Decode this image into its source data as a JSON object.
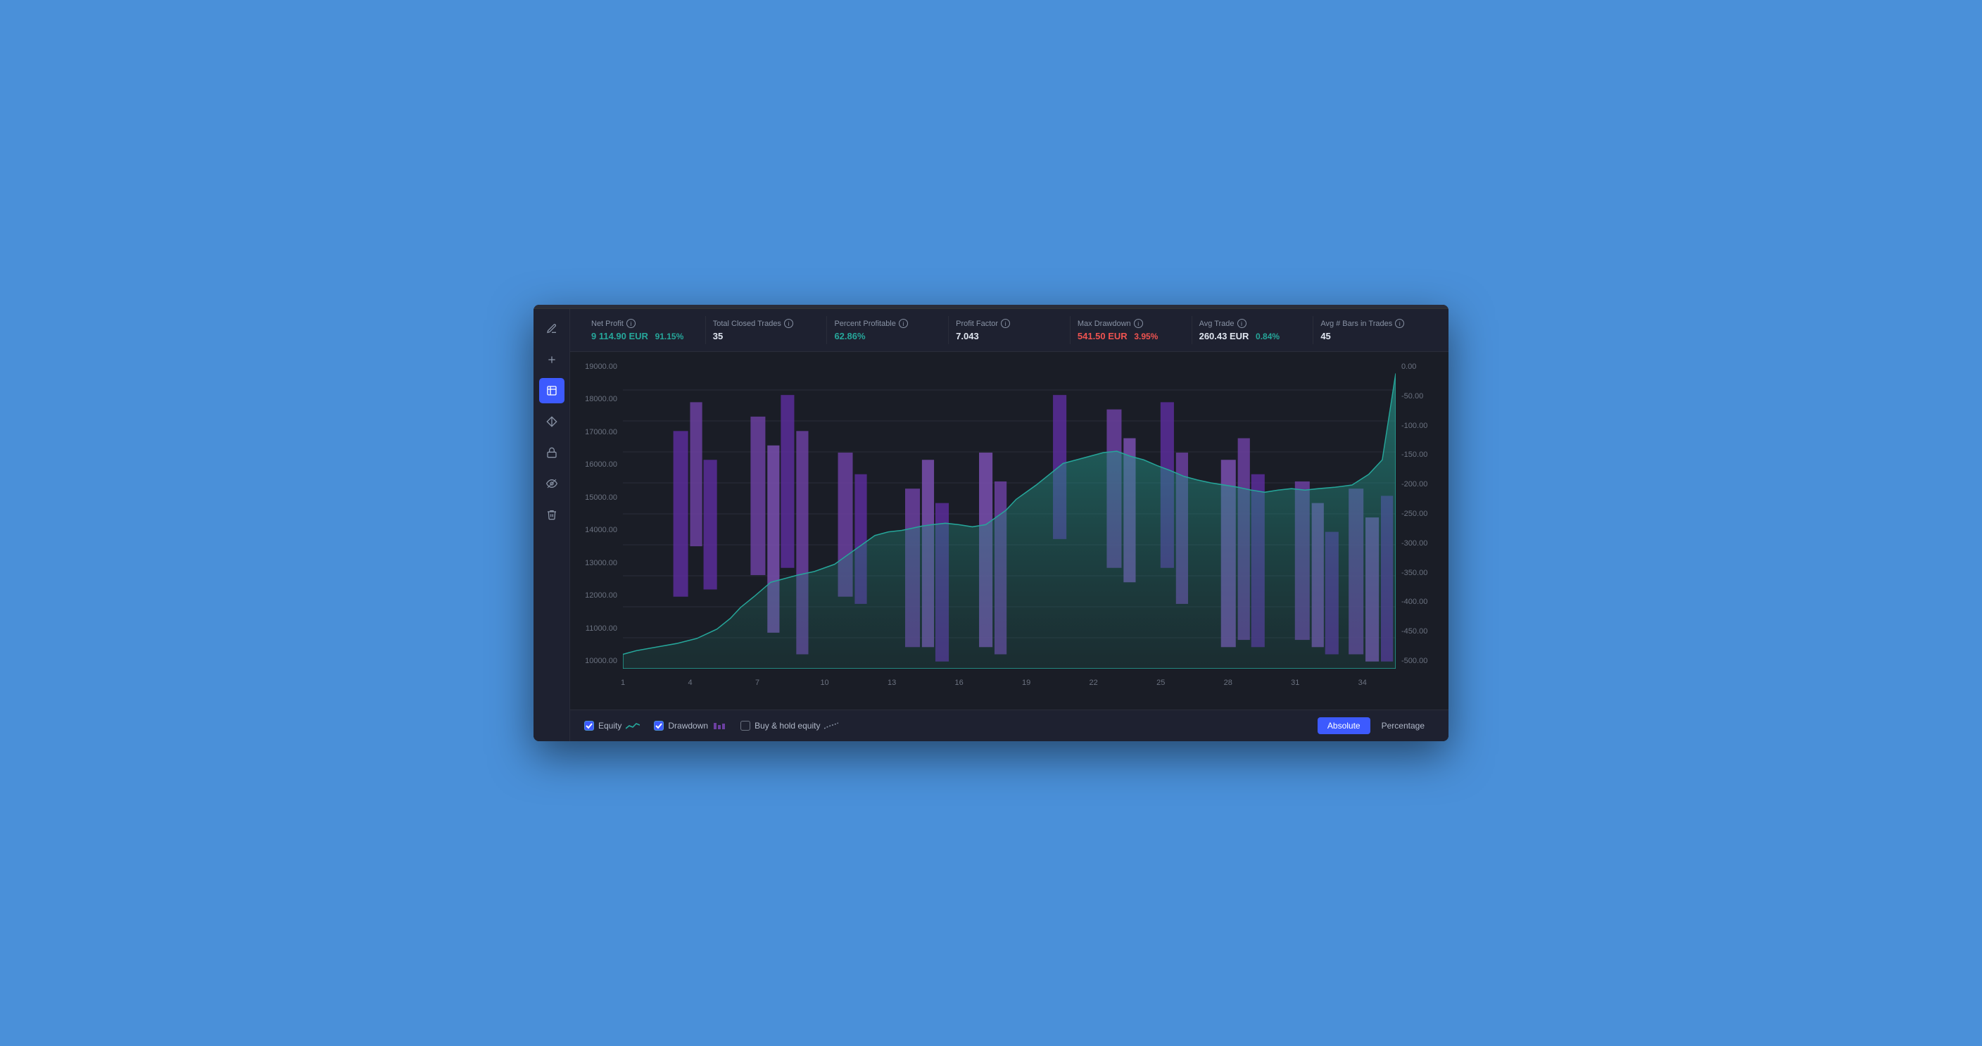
{
  "stats": [
    {
      "id": "net-profit",
      "label": "Net Profit",
      "value": "9 114.90 EUR",
      "secondary": "91.15%",
      "secondary_color": "green"
    },
    {
      "id": "total-closed-trades",
      "label": "Total Closed Trades",
      "value": "35",
      "secondary": null,
      "secondary_color": null
    },
    {
      "id": "percent-profitable",
      "label": "Percent Profitable",
      "value": "62.86%",
      "secondary": null,
      "secondary_color": "green"
    },
    {
      "id": "profit-factor",
      "label": "Profit Factor",
      "value": "7.043",
      "secondary": null,
      "secondary_color": null
    },
    {
      "id": "max-drawdown",
      "label": "Max Drawdown",
      "value": "541.50 EUR",
      "secondary": "3.95%",
      "secondary_color": "red"
    },
    {
      "id": "avg-trade",
      "label": "Avg Trade",
      "value": "260.43 EUR",
      "secondary": "0.84%",
      "secondary_color": "green"
    },
    {
      "id": "avg-bars-in-trades",
      "label": "Avg # Bars in Trades",
      "value": "45",
      "secondary": null,
      "secondary_color": null
    }
  ],
  "y_axis_left": [
    "19000.00",
    "18000.00",
    "17000.00",
    "16000.00",
    "15000.00",
    "14000.00",
    "13000.00",
    "12000.00",
    "11000.00",
    "10000.00"
  ],
  "y_axis_right": [
    "0.00",
    "-50.00",
    "-100.00",
    "-150.00",
    "-200.00",
    "-250.00",
    "-300.00",
    "-350.00",
    "-400.00",
    "-450.00",
    "-500.00"
  ],
  "x_axis": [
    "1",
    "4",
    "7",
    "10",
    "13",
    "16",
    "19",
    "22",
    "25",
    "28",
    "31",
    "34"
  ],
  "legend": [
    {
      "id": "equity",
      "label": "Equity",
      "checked": true,
      "icon": "equity-icon"
    },
    {
      "id": "drawdown",
      "label": "Drawdown",
      "checked": true,
      "icon": "drawdown-icon"
    },
    {
      "id": "buy-hold",
      "label": "Buy & hold equity",
      "checked": false,
      "icon": "line-icon"
    }
  ],
  "view_buttons": [
    {
      "id": "absolute",
      "label": "Absolute",
      "active": true
    },
    {
      "id": "percentage",
      "label": "Percentage",
      "active": false
    }
  ],
  "sidebar_icons": [
    {
      "id": "pencil",
      "icon": "✏️",
      "active": false
    },
    {
      "id": "plus",
      "icon": "＋",
      "active": false
    },
    {
      "id": "cursor",
      "icon": "📌",
      "active": true
    },
    {
      "id": "ruler",
      "icon": "📐",
      "active": false
    },
    {
      "id": "lock",
      "icon": "🔒",
      "active": false
    },
    {
      "id": "eye",
      "icon": "👁",
      "active": false
    },
    {
      "id": "trash",
      "icon": "🗑",
      "active": false
    }
  ],
  "colors": {
    "accent": "#3d5afe",
    "green": "#26a69a",
    "red": "#ef5350",
    "purple_bar": "#6b3fa0",
    "teal_area": "#1e6b5c",
    "background": "#1a1d26"
  }
}
